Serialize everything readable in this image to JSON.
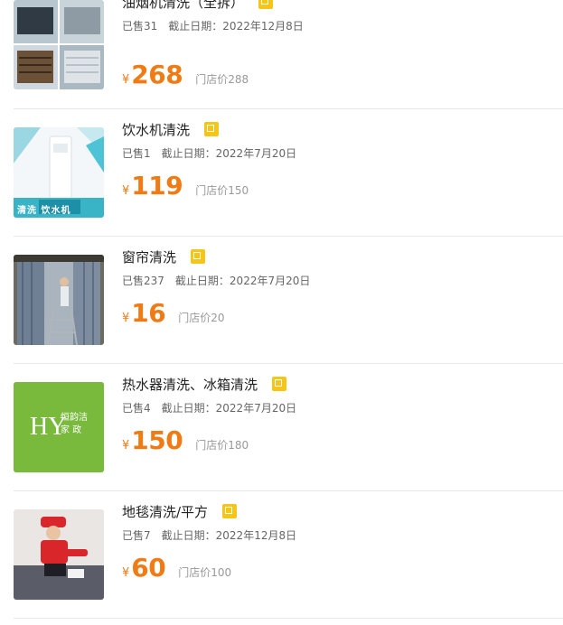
{
  "items": [
    {
      "title": "油烟机清洗（全拆）",
      "sold": "已售31",
      "deadline_label": "截止日期：",
      "deadline": "2022年12月8日",
      "currency": "¥",
      "price": "268",
      "orig_price": "门店价288",
      "badge": "团",
      "image": "range-hood-icon"
    },
    {
      "title": "饮水机清洗",
      "sold": "已售1",
      "deadline_label": "截止日期：",
      "deadline": "2022年7月20日",
      "currency": "¥",
      "price": "119",
      "orig_price": "门店价150",
      "badge": "团",
      "image": "water-dispenser-icon",
      "image_text": "清洗 饮水机"
    },
    {
      "title": "窗帘清洗",
      "sold": "已售237",
      "deadline_label": "截止日期：",
      "deadline": "2022年7月20日",
      "currency": "¥",
      "price": "16",
      "orig_price": "门店价20",
      "badge": "团",
      "image": "curtain-icon"
    },
    {
      "title": "热水器清洗、冰箱清洗",
      "sold": "已售4",
      "deadline_label": "截止日期：",
      "deadline": "2022年7月20日",
      "currency": "¥",
      "price": "150",
      "orig_price": "门店价180",
      "badge": "团",
      "image": "hy-logo-icon",
      "image_text": "恒韵洁 家 政"
    },
    {
      "title": "地毯清洗/平方",
      "sold": "已售7",
      "deadline_label": "截止日期：",
      "deadline": "2022年12月8日",
      "currency": "¥",
      "price": "60",
      "orig_price": "门店价100",
      "badge": "团",
      "image": "carpet-cleaner-icon"
    }
  ]
}
